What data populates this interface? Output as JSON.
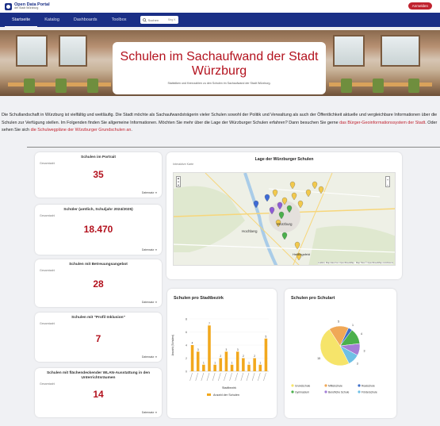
{
  "header": {
    "logo_title": "Open Data Portal",
    "logo_sub": "der Stadt Würzburg",
    "login_label": "Anmelden"
  },
  "nav": {
    "items": [
      "Startseite",
      "Katalog",
      "Dashboards",
      "Toolbox"
    ],
    "search_placeholder": "Suchen",
    "search_shortcut": "Strg K"
  },
  "hero": {
    "title": "Schulen im Sachaufwand der Stadt Würzburg",
    "subtitle": "Statistiken und Kennzahlen zu den Schulen im Sachaufwand der Stadt Würzburg."
  },
  "intro": {
    "part1": "Die Schullandschaft in Würzburg ist vielfältig und weitläufig. Die Stadt möchte als Sachaufwandsträgerin vieler Schulen sowohl der Politik und Verwaltung als auch der Öffentlichkeit aktuelle und vergleichbare Informationen über die Schulen zur Verfügung stellen. Im Folgenden finden Sie allgemeine Informationen. Möchten Sie mehr über die Lage der Würzburger Schulen erfahren? Dann besuchen Sie gerne ",
    "link1": "das Bürger-Geoinformationssystem der Stadt",
    "part2": ". Oder sehen Sie sich ",
    "link2": "die Schulwegpläne der Würzburger Grundschulen an",
    "part3": "."
  },
  "kpis": [
    {
      "title": "Schulen im Portrait",
      "sub": "Gesamtzahl",
      "value": "35",
      "link": "Datensatz"
    },
    {
      "title": "Schüler (amtlich, Schuljahr 2024/2025)",
      "sub": "Gesamtzahl",
      "value": "18.470",
      "link": "Datensatz"
    },
    {
      "title": "Schulen mit Betreuungsangebot",
      "sub": "Gesamtzahl",
      "value": "28",
      "link": "Datensatz"
    },
    {
      "title": "Schulen mit \"Profil Inklusion\"",
      "sub": "Gesamtzahl",
      "value": "7",
      "link": "Datensatz"
    },
    {
      "title": "Schulen mit flächendeckender WLAN-Ausstattung in den Unterrichtsräumen",
      "sub": "Gesamtzahl",
      "value": "14",
      "link": "Datensatz"
    }
  ],
  "map": {
    "title": "Lage der Würzburger Schulen",
    "subtitle": "Interaktive Karte",
    "attribution": "Leaflet | Map data from OpenStreetMap · Map Tiles © OpenStreetMap contributors",
    "places": [
      "Hochberg",
      "Würzburg",
      "Heidingsfeld"
    ],
    "zoom_in": "+",
    "zoom_out": "−"
  },
  "chart_data": [
    {
      "type": "bar",
      "title": "Schulen pro Stadtbezirk",
      "ylabel": "Anzahl (Schulen)",
      "xlabel": "Stadtbezirk",
      "ylim": [
        0,
        8
      ],
      "yticks": [
        "0",
        "2",
        "4",
        "6",
        "8"
      ],
      "values": [
        4,
        3,
        1,
        7,
        1,
        2,
        3,
        1,
        3,
        2,
        1,
        2,
        1,
        5
      ],
      "series": [
        {
          "name": "Anzahl der Schulen",
          "color": "#f2a81d"
        }
      ]
    },
    {
      "type": "pie",
      "title": "Schulen pro Schulart",
      "slices": [
        {
          "label": "Grundschule",
          "value": 15,
          "color": "#f6e46a"
        },
        {
          "label": "Mittelschule",
          "value": 5,
          "color": "#f0a857"
        },
        {
          "label": "Realschule",
          "value": 1,
          "color": "#3e6fc9"
        },
        {
          "label": "Gymnasium",
          "value": 4,
          "color": "#4bb04c"
        },
        {
          "label": "Berufliche Schule",
          "value": 3,
          "color": "#a47ed6"
        },
        {
          "label": "Förderschule",
          "value": 3,
          "color": "#6ec0e5"
        }
      ]
    }
  ]
}
